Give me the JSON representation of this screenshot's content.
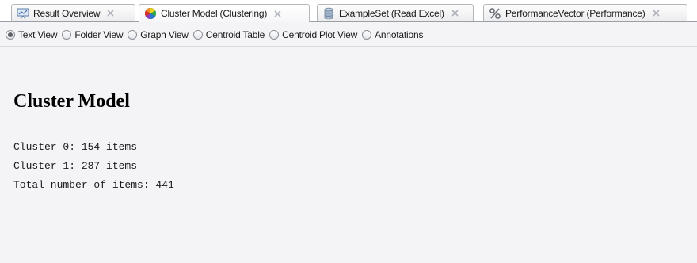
{
  "tabs": [
    {
      "label": "Result Overview",
      "icon": "presentation-icon",
      "active": false
    },
    {
      "label": "Cluster Model (Clustering)",
      "icon": "cluster-model-icon",
      "active": true
    },
    {
      "label": "ExampleSet (Read Excel)",
      "icon": "database-icon",
      "active": false
    },
    {
      "label": "PerformanceVector (Performance)",
      "icon": "percent-icon",
      "active": false
    }
  ],
  "views": [
    {
      "label": "Text View",
      "checked": true
    },
    {
      "label": "Folder View",
      "checked": false
    },
    {
      "label": "Graph View",
      "checked": false
    },
    {
      "label": "Centroid Table",
      "checked": false
    },
    {
      "label": "Centroid Plot View",
      "checked": false
    },
    {
      "label": "Annotations",
      "checked": false
    }
  ],
  "content": {
    "title": "Cluster Model",
    "lines": [
      "Cluster 0: 154 items",
      "Cluster 1: 287 items",
      "Total number of items: 441"
    ]
  },
  "colors": {
    "background": "#f4f4f6",
    "tab_border": "#b3b7bc",
    "radio_dot": "#5d6066"
  }
}
